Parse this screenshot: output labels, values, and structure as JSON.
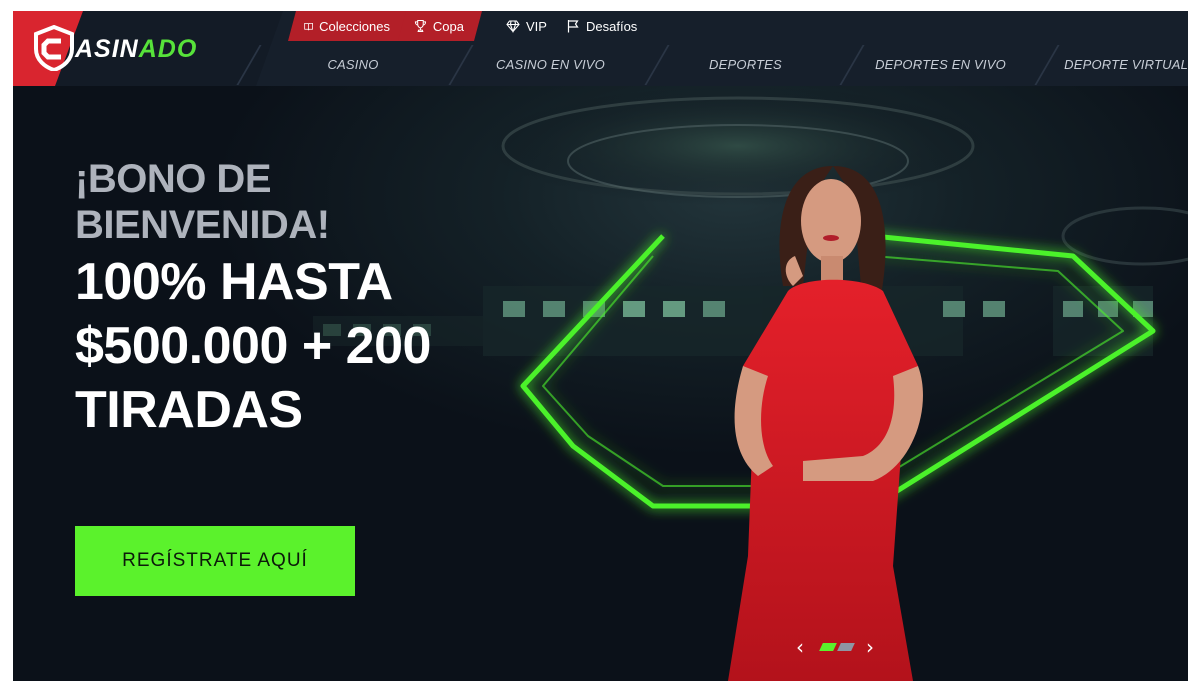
{
  "brand": {
    "logo_left": "ASIN",
    "logo_right": "ADO",
    "logo_alt": "CASINADO",
    "colors": {
      "red": "#d9252f",
      "green": "#57e23a",
      "navy": "#161f2b"
    }
  },
  "topbar": {
    "items": [
      {
        "label": "Colecciones",
        "icon": "book-icon"
      },
      {
        "label": "Copa",
        "icon": "trophy-icon"
      },
      {
        "label": "VIP",
        "icon": "diamond-icon"
      },
      {
        "label": "Desafíos",
        "icon": "flag-icon"
      }
    ]
  },
  "nav": {
    "items": [
      {
        "label": "CASINO"
      },
      {
        "label": "CASINO EN VIVO"
      },
      {
        "label": "DEPORTES"
      },
      {
        "label": "DEPORTES EN VIVO"
      },
      {
        "label": "DEPORTE VIRTUAL"
      }
    ]
  },
  "hero": {
    "line1": "¡BONO DE",
    "line2": "BIENVENIDA!",
    "line3": "100% HASTA",
    "line4": "$500.000 + 200",
    "line5": "TIRADAS",
    "cta_label": "REGÍSTRATE AQUÍ",
    "slider": {
      "prev": "‹",
      "next": "›",
      "active_slide": 1,
      "total_slides": 2,
      "active_color": "#5bf22c",
      "inactive_color": "#8e96a3"
    }
  }
}
